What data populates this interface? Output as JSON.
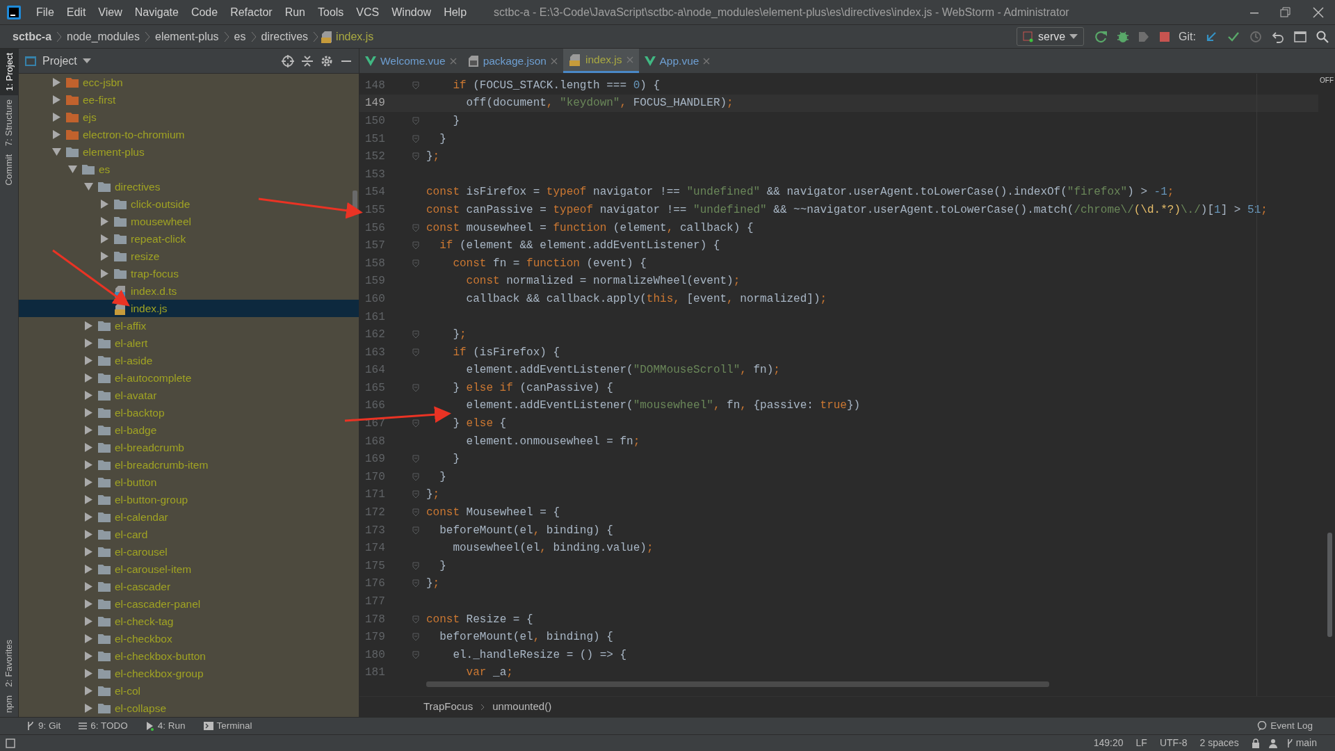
{
  "menu": [
    "File",
    "Edit",
    "View",
    "Navigate",
    "Code",
    "Refactor",
    "Run",
    "Tools",
    "VCS",
    "Window",
    "Help"
  ],
  "window_title": "sctbc-a - E:\\3-Code\\JavaScript\\sctbc-a\\node_modules\\element-plus\\es\\directives\\index.js - WebStorm - Administrator",
  "breadcrumb": [
    {
      "label": "sctbc-a",
      "kind": "project"
    },
    {
      "label": "node_modules",
      "kind": "dir"
    },
    {
      "label": "element-plus",
      "kind": "dir"
    },
    {
      "label": "es",
      "kind": "dir"
    },
    {
      "label": "directives",
      "kind": "dir"
    },
    {
      "label": "index.js",
      "kind": "js"
    }
  ],
  "run_config": "serve",
  "git_label": "Git:",
  "side_tabs": [
    {
      "label": "1: Project",
      "selected": true
    },
    {
      "label": "7: Structure",
      "selected": false
    },
    {
      "label": "Commit",
      "selected": false
    },
    {
      "label": "2: Favorites",
      "selected": false
    },
    {
      "label": "npm",
      "selected": false
    }
  ],
  "project_panel": {
    "title": "Project",
    "tree": [
      {
        "label": "ecc-jsbn",
        "kind": "excluded-folder",
        "expanded": false,
        "selected": false
      },
      {
        "label": "ee-first",
        "kind": "excluded-folder",
        "expanded": false,
        "selected": false
      },
      {
        "label": "ejs",
        "kind": "excluded-folder",
        "expanded": false,
        "selected": false
      },
      {
        "label": "electron-to-chromium",
        "kind": "excluded-folder",
        "expanded": false,
        "selected": false
      },
      {
        "label": "element-plus",
        "kind": "folder",
        "expanded": true,
        "selected": false,
        "children": [
          {
            "label": "es",
            "kind": "folder",
            "expanded": true,
            "selected": false,
            "children": [
              {
                "label": "directives",
                "kind": "folder",
                "expanded": true,
                "selected": false,
                "children": [
                  {
                    "label": "click-outside",
                    "kind": "folder",
                    "expanded": false,
                    "selected": false
                  },
                  {
                    "label": "mousewheel",
                    "kind": "folder",
                    "expanded": false,
                    "selected": false
                  },
                  {
                    "label": "repeat-click",
                    "kind": "folder",
                    "expanded": false,
                    "selected": false
                  },
                  {
                    "label": "resize",
                    "kind": "folder",
                    "expanded": false,
                    "selected": false
                  },
                  {
                    "label": "trap-focus",
                    "kind": "folder",
                    "expanded": false,
                    "selected": false
                  },
                  {
                    "label": "index.d.ts",
                    "kind": "ts-file",
                    "selected": false
                  },
                  {
                    "label": "index.js",
                    "kind": "js-file",
                    "selected": true
                  }
                ]
              },
              {
                "label": "el-affix",
                "kind": "folder",
                "expanded": false,
                "selected": false
              },
              {
                "label": "el-alert",
                "kind": "folder",
                "expanded": false,
                "selected": false
              },
              {
                "label": "el-aside",
                "kind": "folder",
                "expanded": false,
                "selected": false
              },
              {
                "label": "el-autocomplete",
                "kind": "folder",
                "expanded": false,
                "selected": false
              },
              {
                "label": "el-avatar",
                "kind": "folder",
                "expanded": false,
                "selected": false
              },
              {
                "label": "el-backtop",
                "kind": "folder",
                "expanded": false,
                "selected": false
              },
              {
                "label": "el-badge",
                "kind": "folder",
                "expanded": false,
                "selected": false
              },
              {
                "label": "el-breadcrumb",
                "kind": "folder",
                "expanded": false,
                "selected": false
              },
              {
                "label": "el-breadcrumb-item",
                "kind": "folder",
                "expanded": false,
                "selected": false
              },
              {
                "label": "el-button",
                "kind": "folder",
                "expanded": false,
                "selected": false
              },
              {
                "label": "el-button-group",
                "kind": "folder",
                "expanded": false,
                "selected": false
              },
              {
                "label": "el-calendar",
                "kind": "folder",
                "expanded": false,
                "selected": false
              },
              {
                "label": "el-card",
                "kind": "folder",
                "expanded": false,
                "selected": false
              },
              {
                "label": "el-carousel",
                "kind": "folder",
                "expanded": false,
                "selected": false
              },
              {
                "label": "el-carousel-item",
                "kind": "folder",
                "expanded": false,
                "selected": false
              },
              {
                "label": "el-cascader",
                "kind": "folder",
                "expanded": false,
                "selected": false
              },
              {
                "label": "el-cascader-panel",
                "kind": "folder",
                "expanded": false,
                "selected": false
              },
              {
                "label": "el-check-tag",
                "kind": "folder",
                "expanded": false,
                "selected": false
              },
              {
                "label": "el-checkbox",
                "kind": "folder",
                "expanded": false,
                "selected": false
              },
              {
                "label": "el-checkbox-button",
                "kind": "folder",
                "expanded": false,
                "selected": false
              },
              {
                "label": "el-checkbox-group",
                "kind": "folder",
                "expanded": false,
                "selected": false
              },
              {
                "label": "el-col",
                "kind": "folder",
                "expanded": false,
                "selected": false
              },
              {
                "label": "el-collapse",
                "kind": "folder",
                "expanded": false,
                "selected": false
              }
            ]
          }
        ]
      }
    ]
  },
  "tabs": [
    {
      "label": "Welcome.vue",
      "kind": "vue",
      "selected": false
    },
    {
      "label": "package.json",
      "kind": "json",
      "selected": false
    },
    {
      "label": "index.js",
      "kind": "js",
      "selected": true
    },
    {
      "label": "App.vue",
      "kind": "vue",
      "selected": false
    }
  ],
  "inspection": "OFF",
  "code_lines": [
    {
      "number": "148",
      "current": false,
      "fold": true,
      "tokens": [
        {
          "kind": "keyword",
          "text": "    if"
        },
        {
          "kind": "plain",
          "text": " (FOCUS_STACK.length === "
        },
        {
          "kind": "number",
          "text": "0"
        },
        {
          "kind": "plain",
          "text": ") {"
        }
      ]
    },
    {
      "number": "149",
      "current": true,
      "fold": false,
      "tokens": [
        {
          "kind": "plain",
          "text": "      off(document"
        },
        {
          "kind": "punct",
          "text": ","
        },
        {
          "kind": "string",
          "text": " \"keydown\""
        },
        {
          "kind": "punct",
          "text": ","
        },
        {
          "kind": "plain",
          "text": " FOCUS_HANDLER)"
        },
        {
          "kind": "punct",
          "text": ";"
        }
      ]
    },
    {
      "number": "150",
      "current": false,
      "fold": true,
      "tokens": [
        {
          "kind": "plain",
          "text": "    }"
        }
      ]
    },
    {
      "number": "151",
      "current": false,
      "fold": true,
      "tokens": [
        {
          "kind": "plain",
          "text": "  }"
        }
      ]
    },
    {
      "number": "152",
      "current": false,
      "fold": true,
      "tokens": [
        {
          "kind": "plain",
          "text": "}"
        },
        {
          "kind": "punct",
          "text": ";"
        }
      ]
    },
    {
      "number": "153",
      "current": false,
      "fold": false
    },
    {
      "number": "154",
      "current": false,
      "fold": false,
      "tokens": [
        {
          "kind": "keyword",
          "text": "const"
        },
        {
          "kind": "plain",
          "text": " isFirefox = "
        },
        {
          "kind": "keyword",
          "text": "typeof"
        },
        {
          "kind": "plain",
          "text": " navigator !== "
        },
        {
          "kind": "string",
          "text": "\"undefined\""
        },
        {
          "kind": "plain",
          "text": " && navigator.userAgent.toLowerCase().indexOf("
        },
        {
          "kind": "string",
          "text": "\"firefox\""
        },
        {
          "kind": "plain",
          "text": ") > "
        },
        {
          "kind": "number",
          "text": "-1"
        },
        {
          "kind": "punct",
          "text": ";"
        }
      ]
    },
    {
      "number": "155",
      "current": false,
      "fold": false,
      "tokens": [
        {
          "kind": "keyword",
          "text": "const"
        },
        {
          "kind": "plain",
          "text": " canPassive = "
        },
        {
          "kind": "keyword",
          "text": "typeof"
        },
        {
          "kind": "plain",
          "text": " navigator !== "
        },
        {
          "kind": "string",
          "text": "\"undefined\""
        },
        {
          "kind": "plain",
          "text": " && ~~navigator.userAgent.toLowerCase().match("
        },
        {
          "kind": "regex",
          "text": "/chrome\\/"
        },
        {
          "kind": "regex-group",
          "text": "(\\d.*?)"
        },
        {
          "kind": "regex",
          "text": "\\./"
        },
        {
          "kind": "plain",
          "text": ")["
        },
        {
          "kind": "number",
          "text": "1"
        },
        {
          "kind": "plain",
          "text": "] > "
        },
        {
          "kind": "number",
          "text": "51"
        },
        {
          "kind": "punct",
          "text": ";"
        }
      ]
    },
    {
      "number": "156",
      "current": false,
      "fold": true,
      "tokens": [
        {
          "kind": "keyword",
          "text": "const"
        },
        {
          "kind": "plain",
          "text": " mousewheel = "
        },
        {
          "kind": "keyword",
          "text": "function"
        },
        {
          "kind": "plain",
          "text": " (element"
        },
        {
          "kind": "punct",
          "text": ","
        },
        {
          "kind": "plain",
          "text": " callback) {"
        }
      ]
    },
    {
      "number": "157",
      "current": false,
      "fold": true,
      "tokens": [
        {
          "kind": "keyword",
          "text": "  if"
        },
        {
          "kind": "plain",
          "text": " (element && element.addEventListener) {"
        }
      ]
    },
    {
      "number": "158",
      "current": false,
      "fold": true,
      "tokens": [
        {
          "kind": "keyword",
          "text": "    const"
        },
        {
          "kind": "plain",
          "text": " fn = "
        },
        {
          "kind": "keyword",
          "text": "function"
        },
        {
          "kind": "plain",
          "text": " (event) {"
        }
      ]
    },
    {
      "number": "159",
      "current": false,
      "fold": false,
      "tokens": [
        {
          "kind": "keyword",
          "text": "      const"
        },
        {
          "kind": "plain",
          "text": " normalized = normalizeWheel(event)"
        },
        {
          "kind": "punct",
          "text": ";"
        }
      ]
    },
    {
      "number": "160",
      "current": false,
      "fold": false,
      "tokens": [
        {
          "kind": "plain",
          "text": "      callback && callback.apply("
        },
        {
          "kind": "keyword",
          "text": "this"
        },
        {
          "kind": "punct",
          "text": ","
        },
        {
          "kind": "plain",
          "text": " [event"
        },
        {
          "kind": "punct",
          "text": ","
        },
        {
          "kind": "plain",
          "text": " normalized])"
        },
        {
          "kind": "punct",
          "text": ";"
        }
      ]
    },
    {
      "number": "161",
      "current": false,
      "fold": false
    },
    {
      "number": "162",
      "current": false,
      "fold": true,
      "tokens": [
        {
          "kind": "plain",
          "text": "    }"
        },
        {
          "kind": "punct",
          "text": ";"
        }
      ]
    },
    {
      "number": "163",
      "current": false,
      "fold": true,
      "tokens": [
        {
          "kind": "keyword",
          "text": "    if"
        },
        {
          "kind": "plain",
          "text": " (isFirefox) {"
        }
      ]
    },
    {
      "number": "164",
      "current": false,
      "fold": false,
      "tokens": [
        {
          "kind": "plain",
          "text": "      element.addEventListener("
        },
        {
          "kind": "string",
          "text": "\"DOMMouseScroll\""
        },
        {
          "kind": "punct",
          "text": ","
        },
        {
          "kind": "plain",
          "text": " fn)"
        },
        {
          "kind": "punct",
          "text": ";"
        }
      ]
    },
    {
      "number": "165",
      "current": false,
      "fold": true,
      "tokens": [
        {
          "kind": "plain",
          "text": "    } "
        },
        {
          "kind": "keyword",
          "text": "else if"
        },
        {
          "kind": "plain",
          "text": " (canPassive) {"
        }
      ]
    },
    {
      "number": "166",
      "current": false,
      "fold": false,
      "tokens": [
        {
          "kind": "plain",
          "text": "      element.addEventListener("
        },
        {
          "kind": "string",
          "text": "\"mousewheel\""
        },
        {
          "kind": "punct",
          "text": ","
        },
        {
          "kind": "plain",
          "text": " fn"
        },
        {
          "kind": "punct",
          "text": ","
        },
        {
          "kind": "plain",
          "text": " {passive: "
        },
        {
          "kind": "keyword",
          "text": "true"
        },
        {
          "kind": "plain",
          "text": "})"
        }
      ]
    },
    {
      "number": "167",
      "current": false,
      "fold": true,
      "tokens": [
        {
          "kind": "plain",
          "text": "    } "
        },
        {
          "kind": "keyword",
          "text": "else"
        },
        {
          "kind": "plain",
          "text": " {"
        }
      ]
    },
    {
      "number": "168",
      "current": false,
      "fold": false,
      "tokens": [
        {
          "kind": "plain",
          "text": "      element.onmousewheel = fn"
        },
        {
          "kind": "punct",
          "text": ";"
        }
      ]
    },
    {
      "number": "169",
      "current": false,
      "fold": true,
      "tokens": [
        {
          "kind": "plain",
          "text": "    }"
        }
      ]
    },
    {
      "number": "170",
      "current": false,
      "fold": true,
      "tokens": [
        {
          "kind": "plain",
          "text": "  }"
        }
      ]
    },
    {
      "number": "171",
      "current": false,
      "fold": true,
      "tokens": [
        {
          "kind": "plain",
          "text": "}"
        },
        {
          "kind": "punct",
          "text": ";"
        }
      ]
    },
    {
      "number": "172",
      "current": false,
      "fold": true,
      "tokens": [
        {
          "kind": "keyword",
          "text": "const"
        },
        {
          "kind": "plain",
          "text": " Mousewheel = {"
        }
      ]
    },
    {
      "number": "173",
      "current": false,
      "fold": true,
      "tokens": [
        {
          "kind": "plain",
          "text": "  beforeMount(el"
        },
        {
          "kind": "punct",
          "text": ","
        },
        {
          "kind": "plain",
          "text": " binding) {"
        }
      ]
    },
    {
      "number": "174",
      "current": false,
      "fold": false,
      "tokens": [
        {
          "kind": "plain",
          "text": "    mousewheel(el"
        },
        {
          "kind": "punct",
          "text": ","
        },
        {
          "kind": "plain",
          "text": " binding.value)"
        },
        {
          "kind": "punct",
          "text": ";"
        }
      ]
    },
    {
      "number": "175",
      "current": false,
      "fold": true,
      "tokens": [
        {
          "kind": "plain",
          "text": "  }"
        }
      ]
    },
    {
      "number": "176",
      "current": false,
      "fold": true,
      "tokens": [
        {
          "kind": "plain",
          "text": "}"
        },
        {
          "kind": "punct",
          "text": ";"
        }
      ]
    },
    {
      "number": "177",
      "current": false,
      "fold": false
    },
    {
      "number": "178",
      "current": false,
      "fold": true,
      "tokens": [
        {
          "kind": "keyword",
          "text": "const"
        },
        {
          "kind": "plain",
          "text": " Resize = {"
        }
      ]
    },
    {
      "number": "179",
      "current": false,
      "fold": true,
      "tokens": [
        {
          "kind": "plain",
          "text": "  beforeMount(el"
        },
        {
          "kind": "punct",
          "text": ","
        },
        {
          "kind": "plain",
          "text": " binding) {"
        }
      ]
    },
    {
      "number": "180",
      "current": false,
      "fold": true,
      "tokens": [
        {
          "kind": "plain",
          "text": "    el._handleResize = () => {"
        }
      ]
    },
    {
      "number": "181",
      "current": false,
      "fold": false,
      "tokens": [
        {
          "kind": "keyword",
          "text": "      var"
        },
        {
          "kind": "plain",
          "text": " _a"
        },
        {
          "kind": "punct",
          "text": ";"
        }
      ]
    }
  ],
  "editor_breadcrumb": [
    "TrapFocus",
    "unmounted()"
  ],
  "bottom_tools": [
    {
      "label": "9: Git",
      "kind": "git"
    },
    {
      "label": "6: TODO",
      "kind": "todo"
    },
    {
      "label": "4: Run",
      "kind": "run"
    },
    {
      "label": "Terminal",
      "kind": "terminal"
    }
  ],
  "event_log": "Event Log",
  "status": [
    "149:20",
    "LF",
    "UTF-8",
    "2 spaces"
  ],
  "branch": "main"
}
